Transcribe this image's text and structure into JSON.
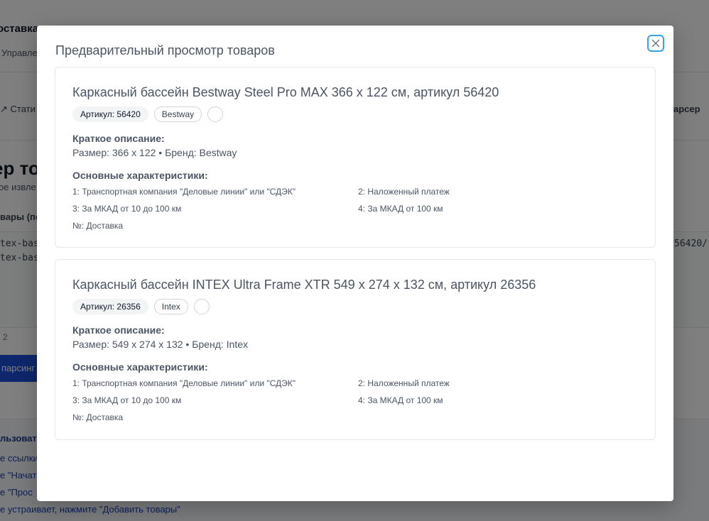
{
  "background": {
    "brand": "оставка",
    "manage": "Управле",
    "tab_stats": "↗ Стати",
    "tab_parser": "арсер",
    "heading": "ер тов",
    "subheading": "ое извле",
    "field_label": "вары (по",
    "code_lines": [
      "tex-bas",
      "tex-bas"
    ],
    "code_right": "56420/",
    "count": "2",
    "start_button": "парсинг",
    "help_title": "льзовать",
    "help_lines": [
      "е ссылки",
      "е \"Начат",
      "е \"Прос",
      "е устраивает, нажмите \"Добавить товары\""
    ]
  },
  "modal": {
    "title": "Предварительный просмотр товаров",
    "close_label": "×"
  },
  "products": [
    {
      "title": "Каркасный бассейн Bestway Steel Pro MAX 366 x 122 см, артикул 56420",
      "sku_badge": "Артикул: 56420",
      "brand_badge": "Bestway",
      "short_desc_title": "Краткое описание:",
      "short_desc": "Размер: 366 x 122 • Бренд: Bestway",
      "specs_title": "Основные характеристики:",
      "specs": [
        "1: Транспортная компания \"Деловые линии\" или \"СДЭК\"",
        "2: Наложенный платеж",
        "3: За МКАД от 10 до 100 км",
        "4: За МКАД от 100 км",
        "№: Доставка"
      ]
    },
    {
      "title": "Каркасный бассейн INTEX Ultra Frame XTR 549 x 274 x 132 см, артикул 26356",
      "sku_badge": "Артикул: 26356",
      "brand_badge": "Intex",
      "short_desc_title": "Краткое описание:",
      "short_desc": "Размер: 549 x 274 x 132 • Бренд: Intex",
      "specs_title": "Основные характеристики:",
      "specs": [
        "1: Транспортная компания \"Деловые линии\" или \"СДЭК\"",
        "2: Наложенный платеж",
        "3: За МКАД от 10 до 100 км",
        "4: За МКАД от 100 км",
        "№: Доставка"
      ]
    }
  ],
  "colors": {
    "overlay": "#000000",
    "close_ring": "#38a3e0",
    "primary_button": "#1d4ed8"
  },
  "icons": {
    "close": "close-icon"
  }
}
